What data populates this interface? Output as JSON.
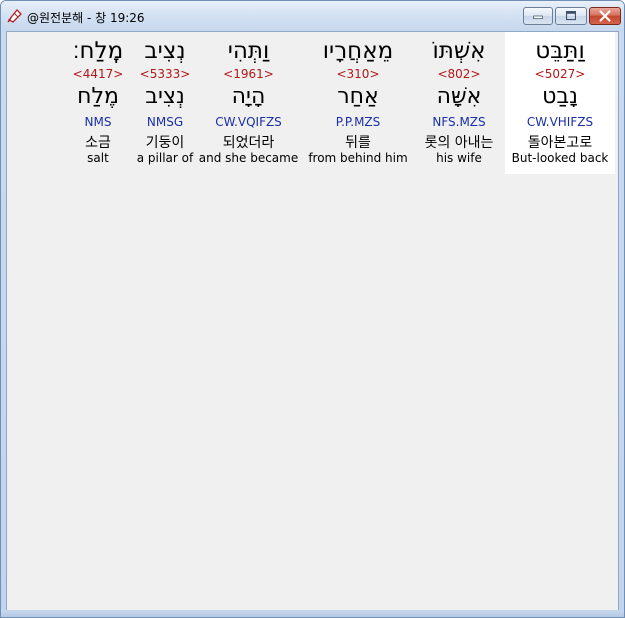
{
  "window": {
    "title": "@원전분해 - 창 19:26"
  },
  "columns": [
    {
      "hebrew": "מֶֽלַח׃",
      "strong": "<4417>",
      "lemma": "מֶלַח",
      "parse": "NMS",
      "korean": "소금",
      "english": "salt",
      "selected": false
    },
    {
      "hebrew": "נְצִיב",
      "strong": "<5333>",
      "lemma": "נְצִיב",
      "parse": "NMSG",
      "korean": "기둥이",
      "english": "a pillar of",
      "selected": false
    },
    {
      "hebrew": "וַתְּהִי",
      "strong": "<1961>",
      "lemma": "הָיָה",
      "parse": "CW.VQIFZS",
      "korean": "되었더라",
      "english": "and she became",
      "selected": false
    },
    {
      "hebrew": "מֵאַחֲרָיו",
      "strong": "<310>",
      "lemma": "אַחַר",
      "parse": "P.P.MZS",
      "korean": "뒤를",
      "english": "from behind him",
      "selected": false
    },
    {
      "hebrew": "אִשְׁתּוֹ",
      "strong": "<802>",
      "lemma": "אִשָּׁה",
      "parse": "NFS.MZS",
      "korean": "롯의 아내는",
      "english": "his wife",
      "selected": false
    },
    {
      "hebrew": "וַתַּבֵּט",
      "strong": "<5027>",
      "lemma": "נָבַט",
      "parse": "CW.VHIFZS",
      "korean": "돌아본고로",
      "english": "But-looked back",
      "selected": true
    }
  ]
}
